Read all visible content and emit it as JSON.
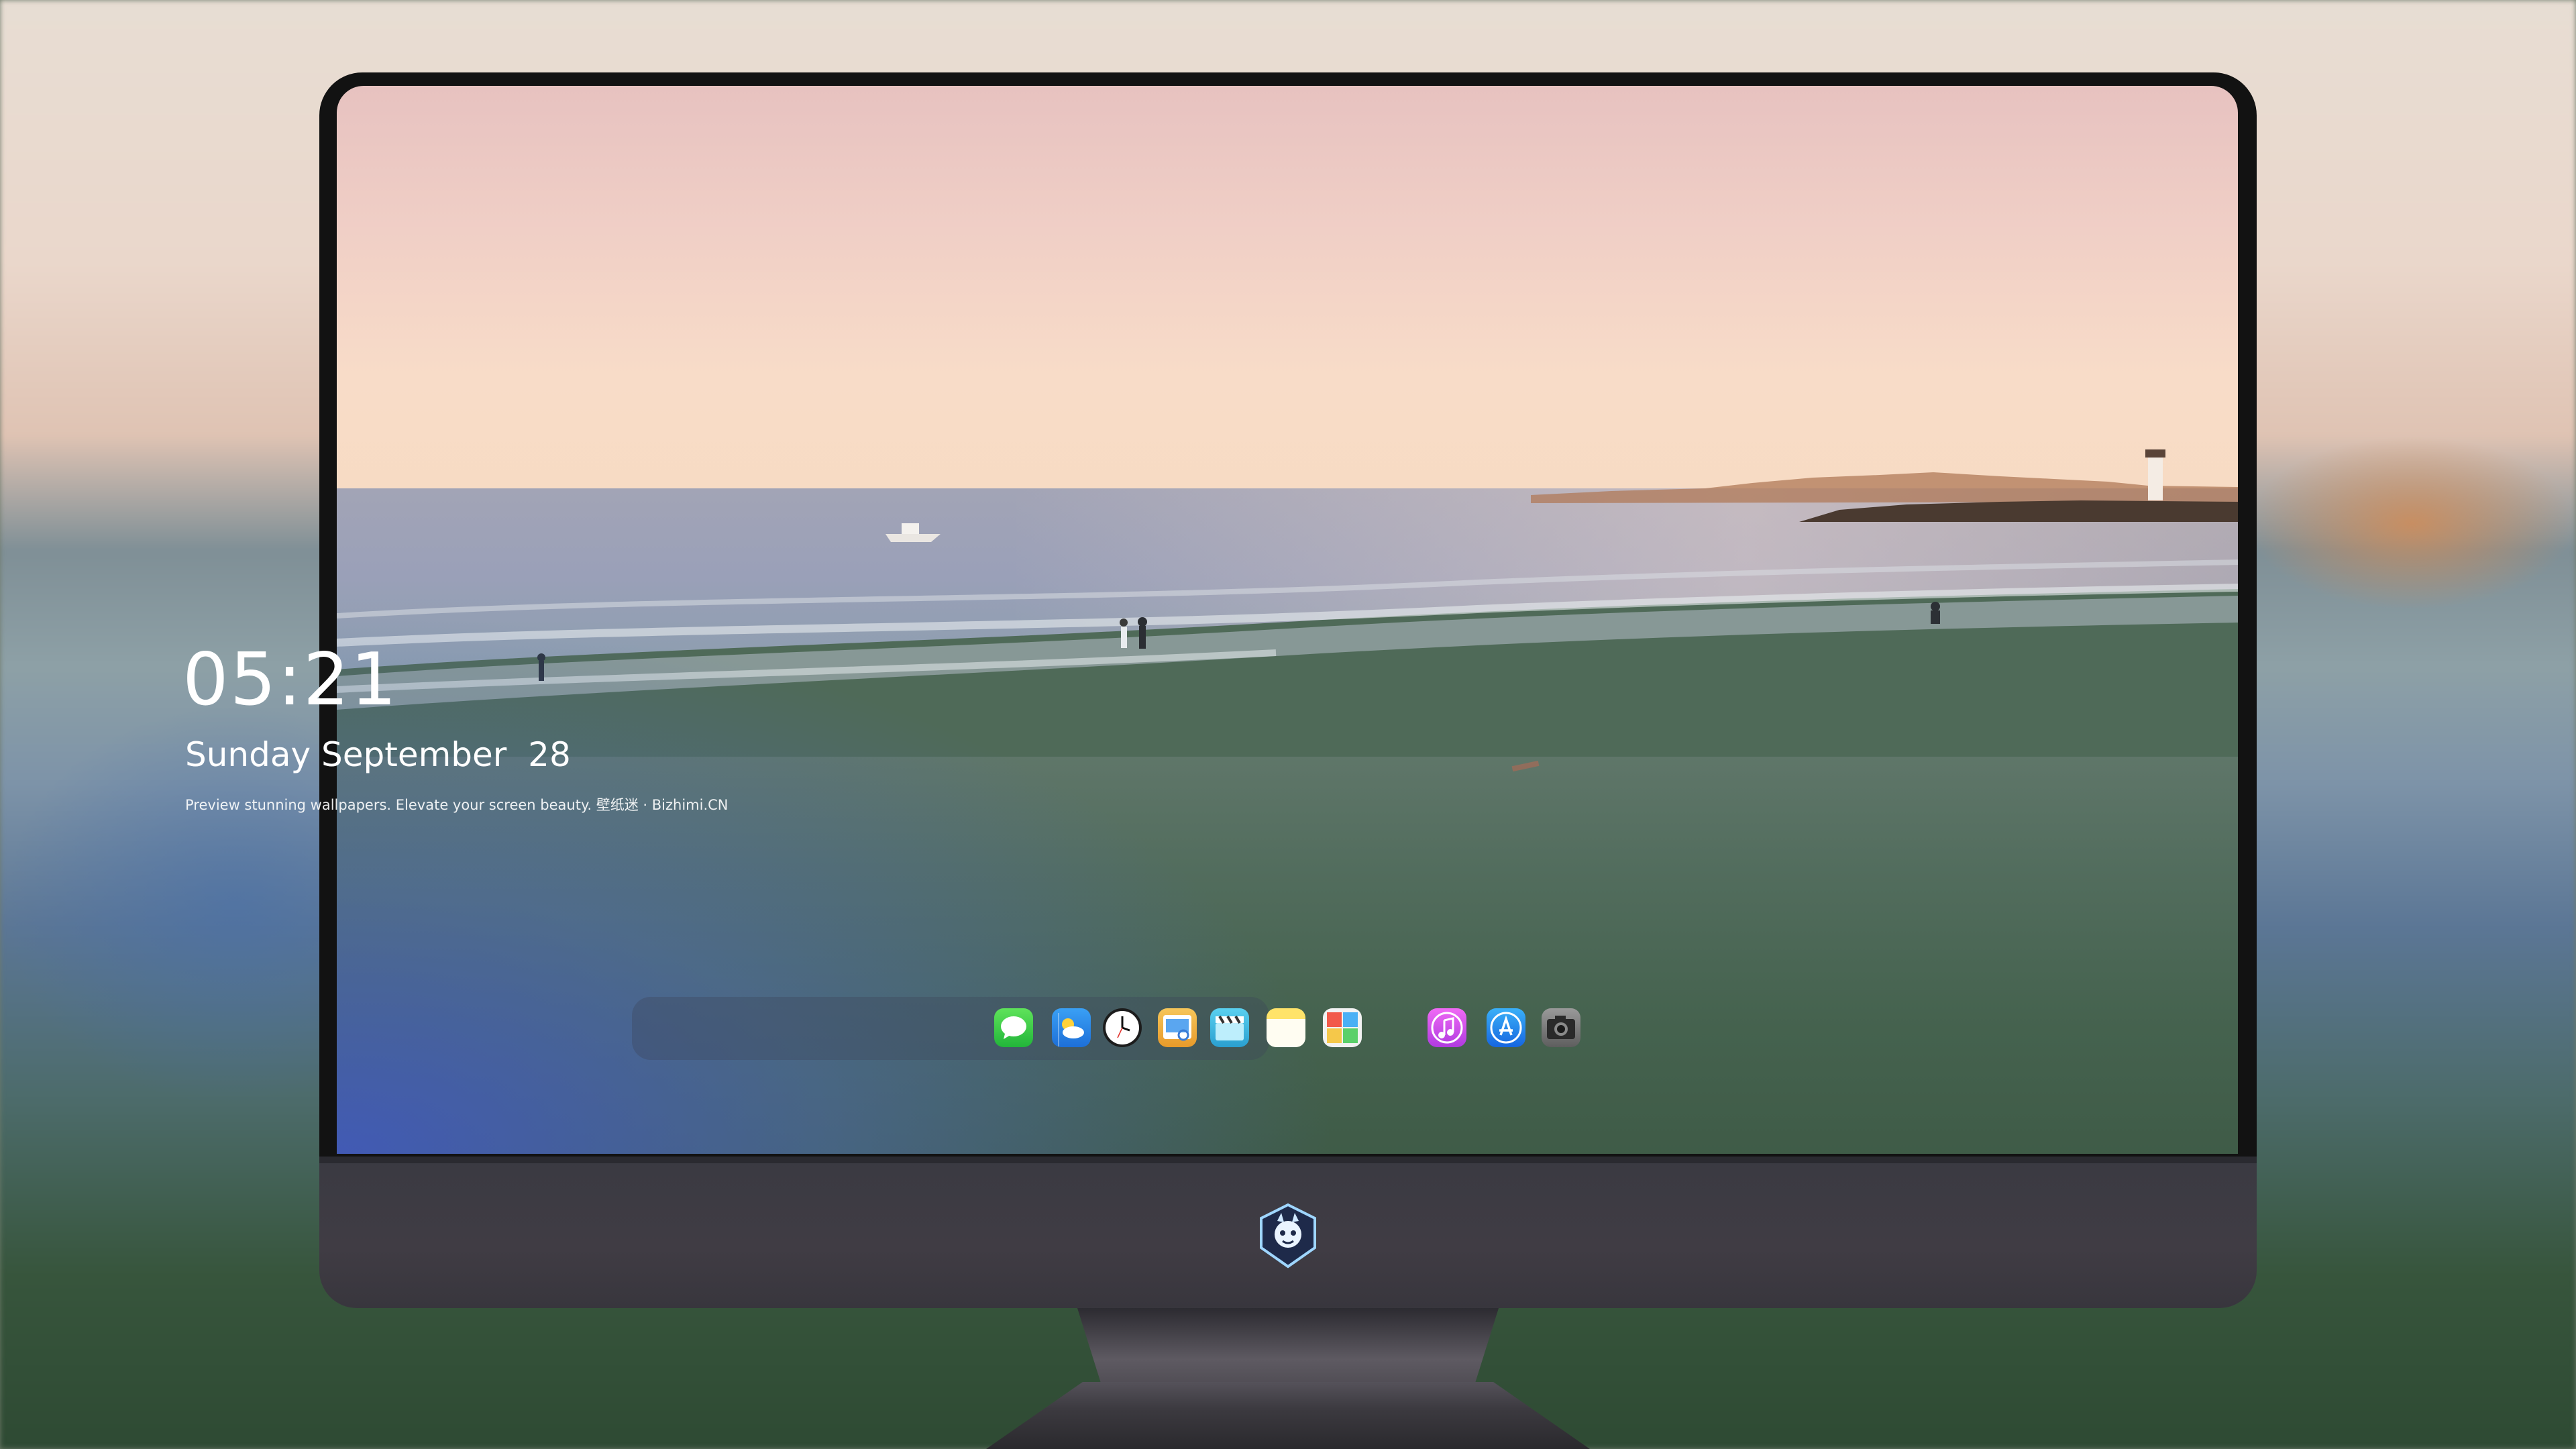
{
  "lock_screen": {
    "time": "05:21",
    "date": "Sunday September  28",
    "tagline": "Preview stunning wallpapers. Elevate your screen beauty. 壁纸迷 · Bizhimi.CN"
  },
  "dock": {
    "apps": [
      {
        "name": "messages-icon",
        "color": "#28c840"
      },
      {
        "name": "weather-icon",
        "color": "#2d8cf0"
      },
      {
        "name": "clock-icon",
        "color": "#1a1a1a"
      },
      {
        "name": "preview-icon",
        "color": "#f0b429"
      },
      {
        "name": "claquette-icon",
        "color": "#3fb6e0"
      },
      {
        "name": "notes-icon",
        "color": "#ffd84d"
      },
      {
        "name": "photo-booth-icon",
        "color": "#e04848"
      },
      {
        "name": "itunes-icon",
        "color": "#d048e0"
      },
      {
        "name": "app-store-icon",
        "color": "#1e7bf0"
      },
      {
        "name": "camera-icon",
        "color": "#8a8a8a"
      }
    ]
  },
  "monitor": {
    "logo": "dragon-mascot-logo"
  }
}
